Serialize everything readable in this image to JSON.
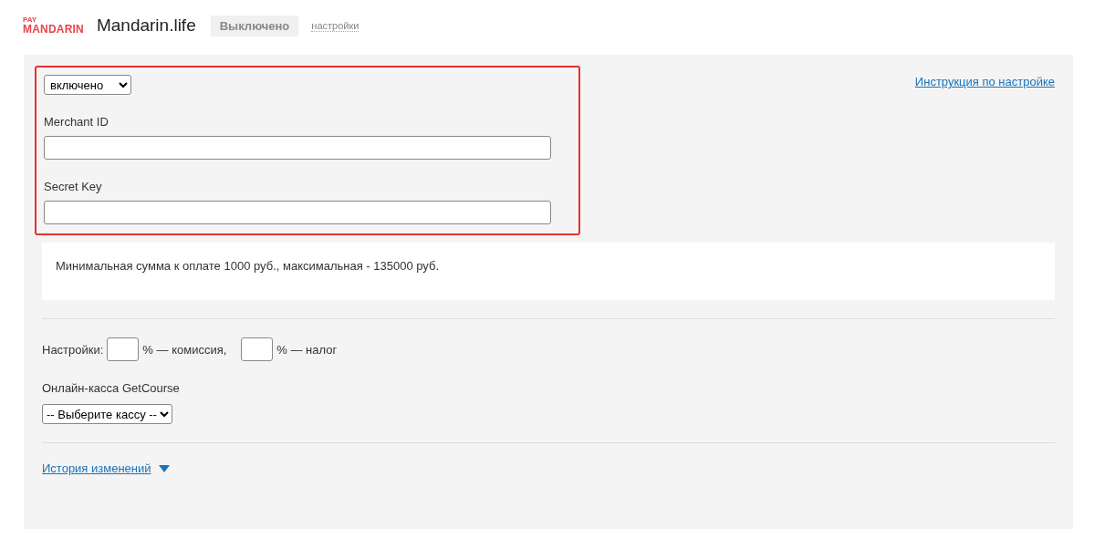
{
  "header": {
    "logo_small": "PAY",
    "logo": "MANDARIN",
    "title": "Mandarin.life",
    "status": "Выключено",
    "settings_link": "настройки"
  },
  "form": {
    "status_select": "включено",
    "instruction_link": "Инструкция по настройке",
    "highlighted": true,
    "fields": [
      {
        "label": "Merchant ID"
      },
      {
        "label": "Secret Key"
      }
    ],
    "notice": "Минимальная сумма к оплате 1000 руб., максимальная - 135000 руб.",
    "settings": {
      "label": "Настройки:",
      "commission_suffix": "% — комиссия,",
      "tax_suffix": "% — налог"
    },
    "cashbox": {
      "label": "Онлайн-касса GetCourse",
      "select": "-- Выберите кассу --"
    },
    "history": {
      "label": "История изменений",
      "expanded": false
    }
  }
}
